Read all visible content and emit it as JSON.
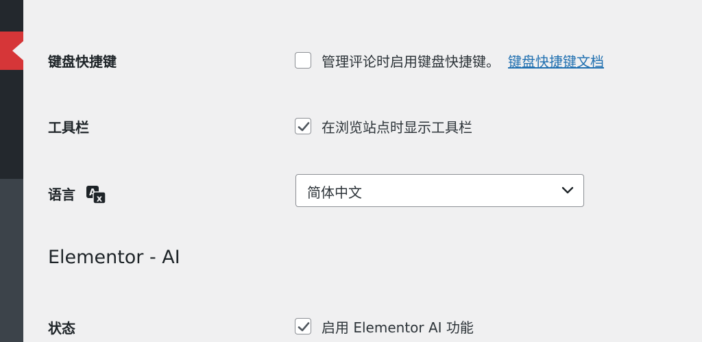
{
  "sidebar": {
    "icon": "admin-menu-active-indicator",
    "colors": {
      "base": "#3c434a",
      "dark": "#23282d",
      "active": "#d63638"
    }
  },
  "rows": {
    "keyboard_shortcuts": {
      "label": "键盘快捷键",
      "checkbox_checked": false,
      "text": "管理评论时启用键盘快捷键。",
      "link": "键盘快捷键文档"
    },
    "toolbar": {
      "label": "工具栏",
      "checkbox_checked": true,
      "text": "在浏览站点时显示工具栏"
    },
    "language": {
      "label": "语言",
      "icon": "translation-icon",
      "selected": "简体中文"
    }
  },
  "section_heading": "Elementor - AI",
  "status": {
    "label": "状态",
    "checkbox_checked": true,
    "text": "启用 Elementor AI 功能"
  },
  "colors": {
    "link": "#2271b1",
    "background": "#f0f0f1"
  }
}
